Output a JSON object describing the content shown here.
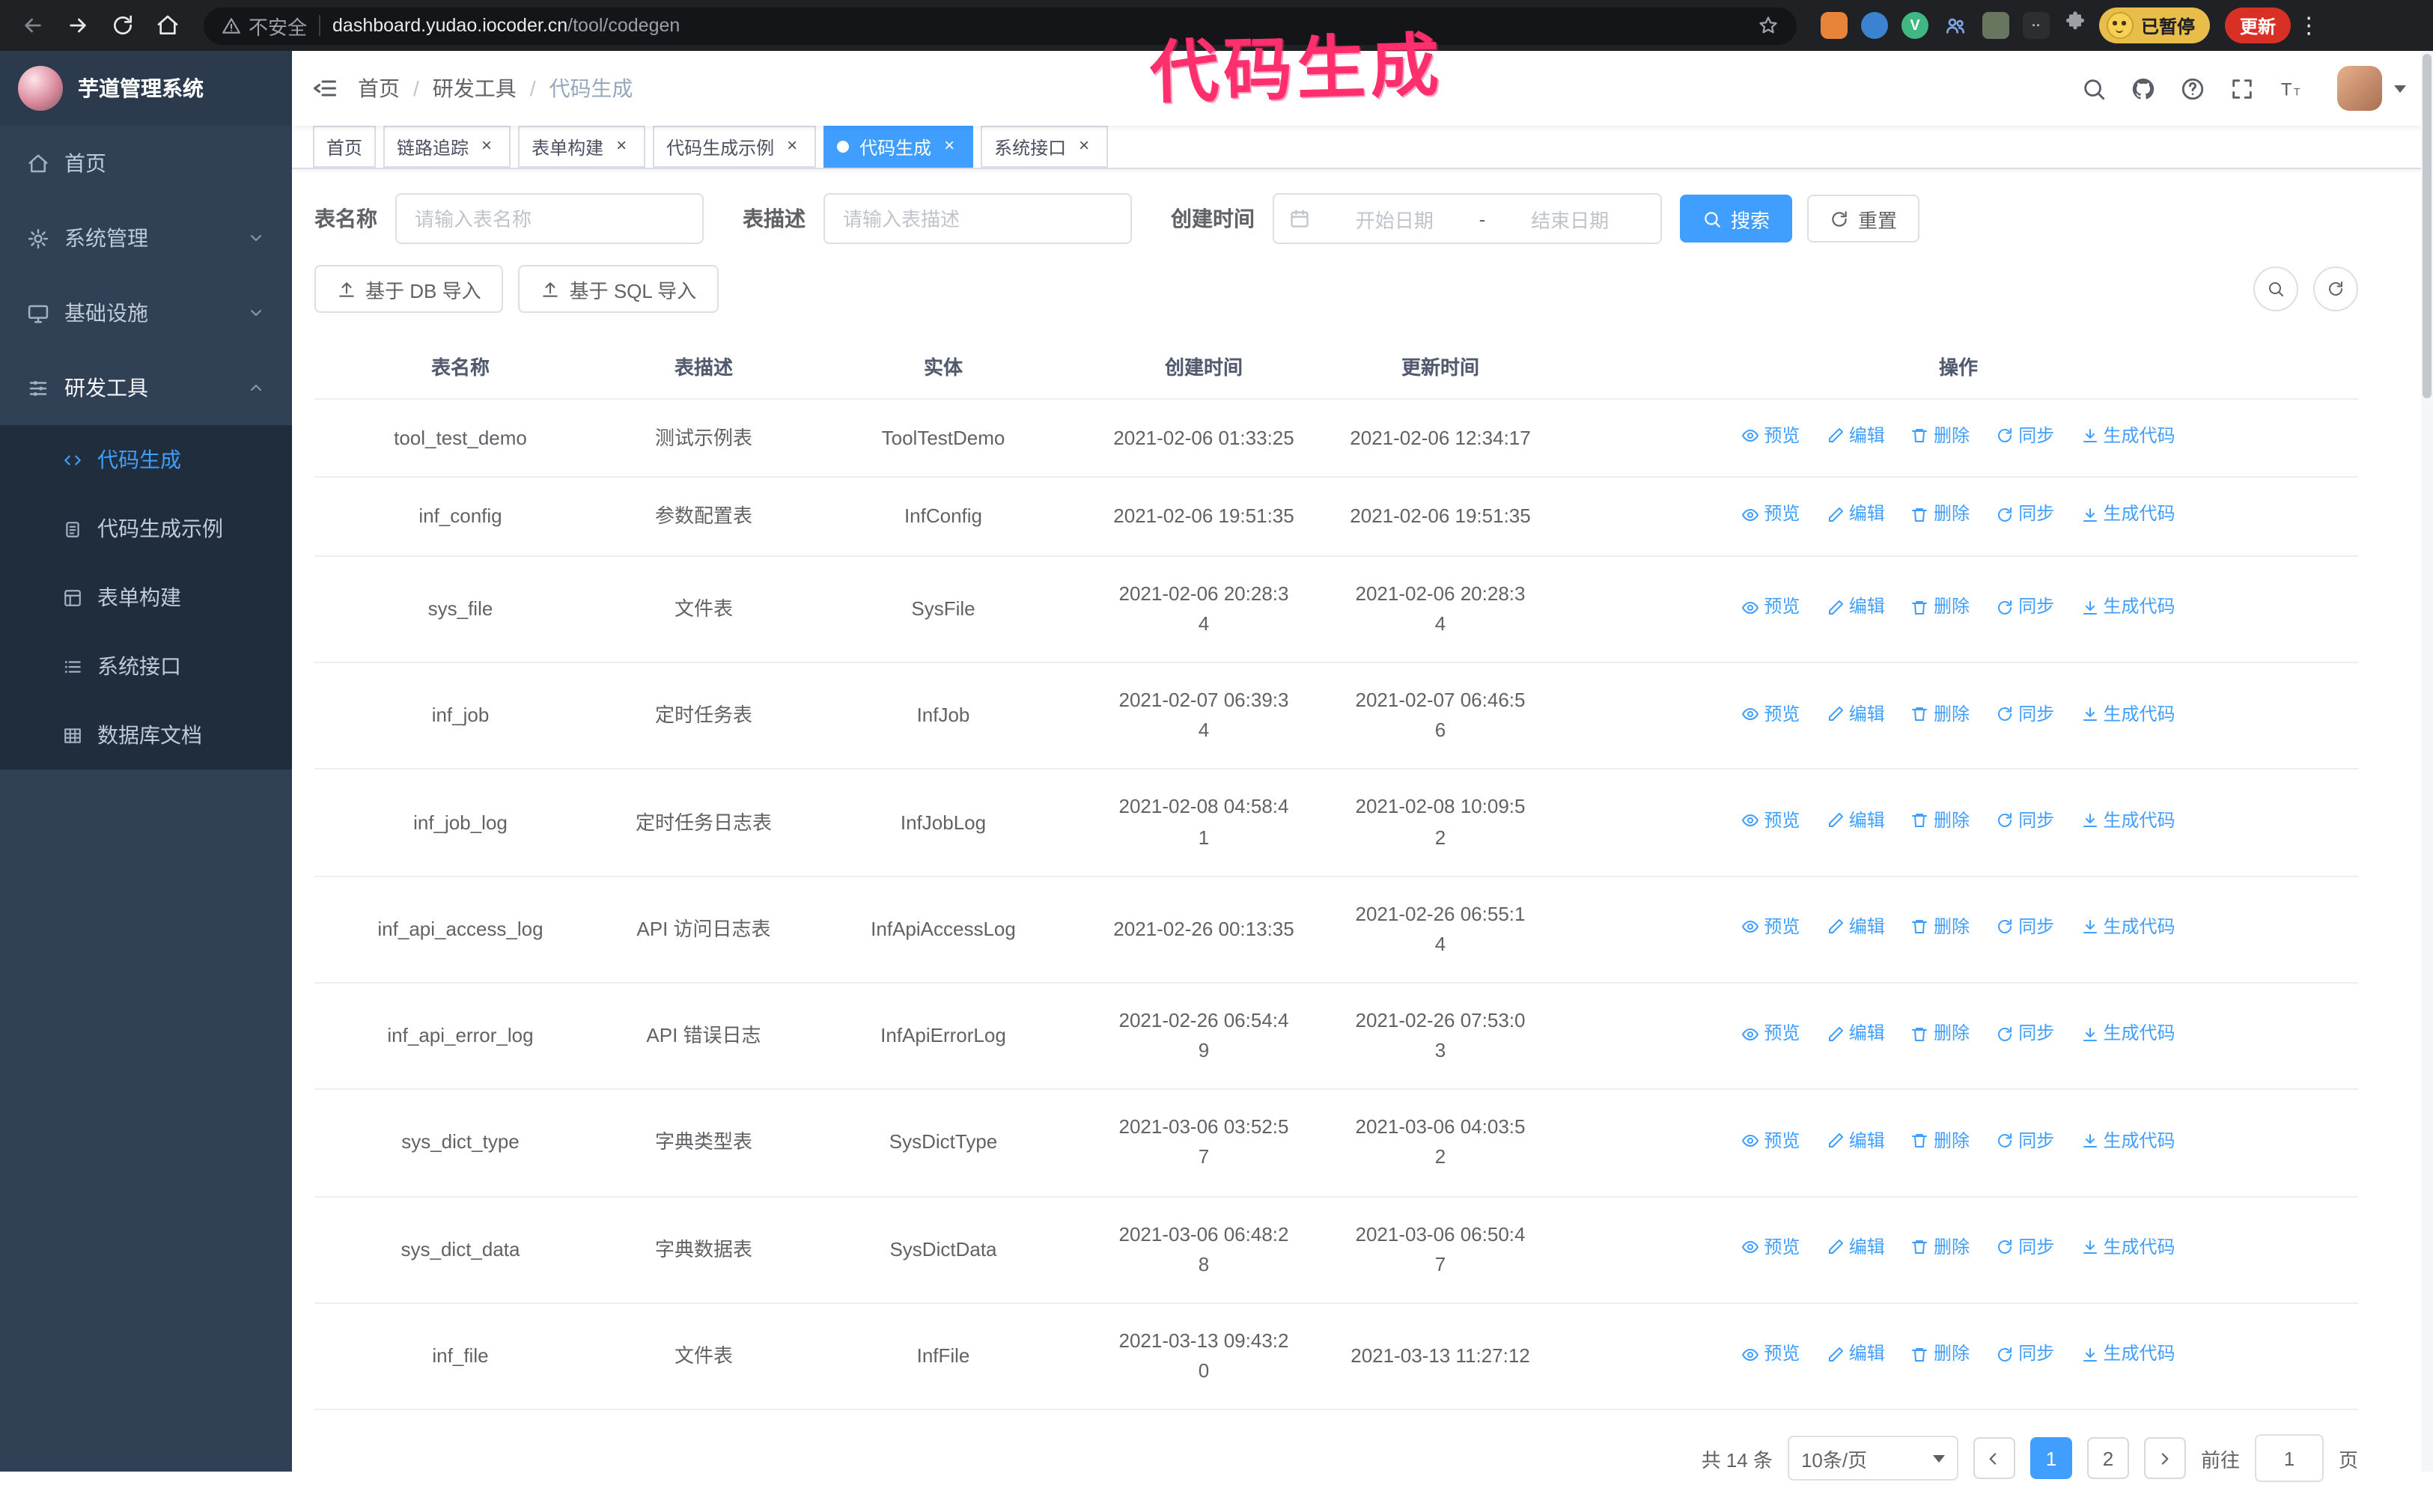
{
  "annotation": {
    "text": "代码生成",
    "color": "#ff2f6e"
  },
  "colors": {
    "accent": "#409eff",
    "sidebar": "#304156",
    "submenu": "#1f2d3d",
    "chrome": "#202124",
    "update_button": "#d93025"
  },
  "browser": {
    "security_text": "不安全",
    "url_host": "dashboard.yudao.iocoder.cn",
    "url_path": "/tool/codegen",
    "vue_badge_letter": "V",
    "paused_badge": "已暂停",
    "update_button": "更新"
  },
  "sidebar": {
    "logo_title": "芋道管理系统",
    "items": [
      {
        "label": "首页"
      },
      {
        "label": "系统管理"
      },
      {
        "label": "基础设施"
      },
      {
        "label": "研发工具"
      }
    ],
    "subitems": [
      {
        "label": "代码生成",
        "active": true
      },
      {
        "label": "代码生成示例"
      },
      {
        "label": "表单构建"
      },
      {
        "label": "系统接口"
      },
      {
        "label": "数据库文档"
      }
    ]
  },
  "header": {
    "breadcrumb": [
      "首页",
      "研发工具",
      "代码生成"
    ]
  },
  "tags": [
    {
      "label": "首页"
    },
    {
      "label": "链路追踪"
    },
    {
      "label": "表单构建"
    },
    {
      "label": "代码生成示例"
    },
    {
      "label": "代码生成"
    },
    {
      "label": "系统接口"
    }
  ],
  "filters": {
    "table_name_label": "表名称",
    "table_name_placeholder": "请输入表名称",
    "table_desc_label": "表描述",
    "table_desc_placeholder": "请输入表描述",
    "create_time_label": "创建时间",
    "date_start_placeholder": "开始日期",
    "date_separator": "-",
    "date_end_placeholder": "结束日期",
    "search_button": "搜索",
    "reset_button": "重置"
  },
  "toolbar": {
    "import_db_button": "基于 DB 导入",
    "import_sql_button": "基于 SQL 导入"
  },
  "table": {
    "columns": [
      "表名称",
      "表描述",
      "实体",
      "创建时间",
      "更新时间",
      "操作"
    ],
    "actions": [
      "预览",
      "编辑",
      "删除",
      "同步",
      "生成代码"
    ],
    "rows": [
      {
        "name": "tool_test_demo",
        "desc": "测试示例表",
        "entity": "ToolTestDemo",
        "created": "2021-02-06 01:33:25",
        "updated": "2021-02-06 12:34:17"
      },
      {
        "name": "inf_config",
        "desc": "参数配置表",
        "entity": "InfConfig",
        "created": "2021-02-06 19:51:35",
        "updated": "2021-02-06 19:51:35"
      },
      {
        "name": "sys_file",
        "desc": "文件表",
        "entity": "SysFile",
        "created": "2021-02-06 20:28:3\n4",
        "updated": "2021-02-06 20:28:3\n4"
      },
      {
        "name": "inf_job",
        "desc": "定时任务表",
        "entity": "InfJob",
        "created": "2021-02-07 06:39:3\n4",
        "updated": "2021-02-07 06:46:5\n6"
      },
      {
        "name": "inf_job_log",
        "desc": "定时任务日志表",
        "entity": "InfJobLog",
        "created": "2021-02-08 04:58:4\n1",
        "updated": "2021-02-08 10:09:5\n2"
      },
      {
        "name": "inf_api_access_log",
        "desc": "API 访问日志表",
        "entity": "InfApiAccessLog",
        "created": "2021-02-26 00:13:35",
        "updated": "2021-02-26 06:55:1\n4"
      },
      {
        "name": "inf_api_error_log",
        "desc": "API 错误日志",
        "entity": "InfApiErrorLog",
        "created": "2021-02-26 06:54:4\n9",
        "updated": "2021-02-26 07:53:0\n3"
      },
      {
        "name": "sys_dict_type",
        "desc": "字典类型表",
        "entity": "SysDictType",
        "created": "2021-03-06 03:52:5\n7",
        "updated": "2021-03-06 04:03:5\n2"
      },
      {
        "name": "sys_dict_data",
        "desc": "字典数据表",
        "entity": "SysDictData",
        "created": "2021-03-06 06:48:2\n8",
        "updated": "2021-03-06 06:50:4\n7"
      },
      {
        "name": "inf_file",
        "desc": "文件表",
        "entity": "InfFile",
        "created": "2021-03-13 09:43:2\n0",
        "updated": "2021-03-13 11:27:12"
      }
    ]
  },
  "pagination": {
    "total": "共 14 条",
    "page_size": "10条/页",
    "pages": [
      "1",
      "2"
    ],
    "current": "1",
    "goto_label": "前往",
    "goto_value": "1",
    "page_suffix": "页"
  }
}
